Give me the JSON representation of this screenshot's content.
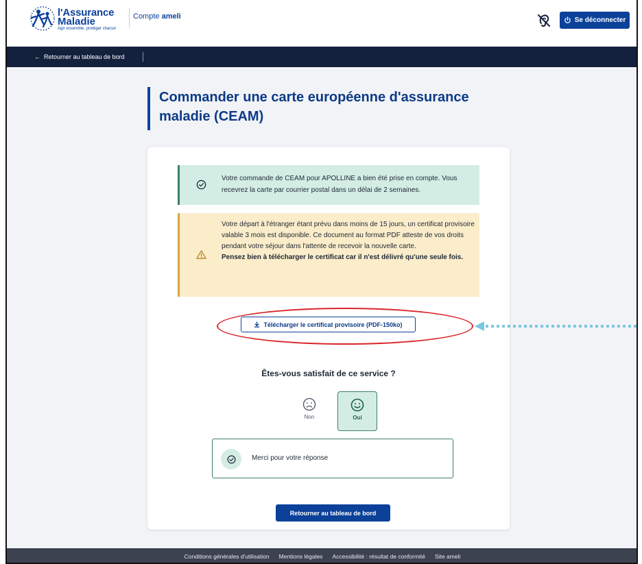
{
  "header": {
    "logo_line1": "l'Assurance",
    "logo_line2": "Maladie",
    "logo_tagline": "Agir ensemble, protéger chacun",
    "account_prefix": "Compte",
    "account_name": "ameli",
    "logout_label": "Se déconnecter",
    "accessibility_icon": "ear-slash-icon"
  },
  "nav": {
    "back_label": "Retourner au tableau de bord"
  },
  "page": {
    "title": "Commander une carte européenne d'assurance maladie (CEAM)"
  },
  "success_alert": {
    "text": "Votre commande de CEAM pour APOLLINE a bien été prise en compte. Vous recevrez la carte par courrier postal dans un délai de 2 semaines.",
    "icon": "check-circle-icon"
  },
  "warning_alert": {
    "text": "Votre départ à l'étranger étant prévu dans moins de 15 jours, un certificat provisoire valable 3 mois est disponible. Ce document au format PDF atteste de vos droits pendant votre séjour dans l'attente de recevoir la nouvelle carte.",
    "bold_text": "Pensez bien à télécharger le certificat car il n'est délivré qu'une seule fois.",
    "icon": "warning-triangle-icon"
  },
  "download": {
    "label": "Télécharger le certificat provisoire (PDF-150ko)",
    "icon": "download-icon"
  },
  "satisfaction": {
    "question": "Êtes-vous satisfait de ce service ?",
    "no_label": "Non",
    "yes_label": "Oui",
    "selected": "Oui"
  },
  "confirmation": {
    "text": "Merci pour votre réponse"
  },
  "dashboard_button": {
    "label": "Retourner au tableau de bord"
  },
  "footer": {
    "links": [
      "Conditions générales d'utilisation",
      "Mentions légales",
      "Accessibilité : résultat de conformité",
      "Site ameli"
    ]
  },
  "colors": {
    "brand_blue": "#0c419a",
    "navbar": "#14213d",
    "success_bg": "#d3ede5",
    "warning_bg": "#fbecca",
    "annotation_red": "#d8262a",
    "annotation_arrow": "#7cc6e0"
  }
}
